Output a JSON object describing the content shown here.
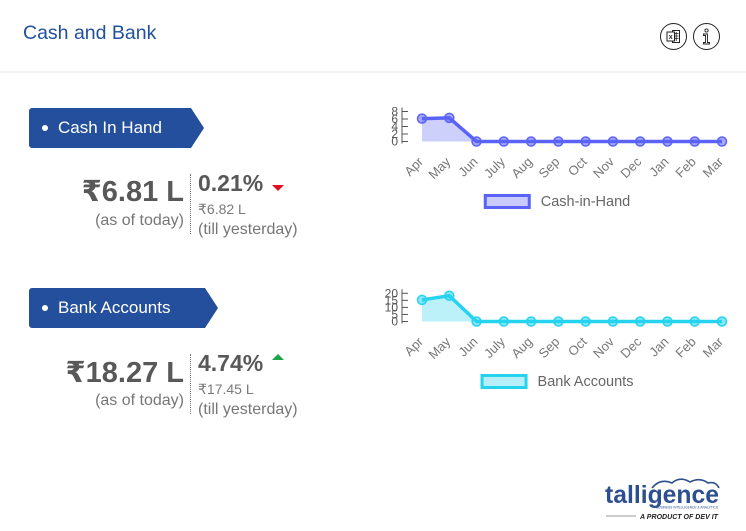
{
  "header": {
    "title": "Cash and Bank",
    "excel_icon": "excel-export-icon",
    "info_icon": "info-icon"
  },
  "colors": {
    "title": "#22509c",
    "pill": "#244f9c",
    "trend_down": "#e01020",
    "trend_up": "#19a64a"
  },
  "sections": [
    {
      "label": "Cash In Hand",
      "value": "₹6.81 L",
      "value_caption": "(as of today)",
      "change_percent": "0.21%",
      "change_direction": "down",
      "previous_value": "₹6.82 L",
      "previous_caption": "(till yesterday)"
    },
    {
      "label": "Bank Accounts",
      "value": "₹18.27 L",
      "value_caption": "(as of today)",
      "change_percent": "4.74%",
      "change_direction": "up",
      "previous_value": "₹17.45 L",
      "previous_caption": "(till yesterday)"
    }
  ],
  "chart_data": [
    {
      "type": "area",
      "title": "",
      "xlabel": "",
      "ylabel": "",
      "categories": [
        "Apr",
        "May",
        "Jun",
        "July",
        "Aug",
        "Sep",
        "Oct",
        "Nov",
        "Dec",
        "Jan",
        "Feb",
        "Mar"
      ],
      "series": [
        {
          "name": "Cash-in-Hand",
          "values": [
            6.1,
            6.3,
            0,
            0,
            0,
            0,
            0,
            0,
            0,
            0,
            0,
            0
          ],
          "line_color": "#5b63f6",
          "fill_color": "#c8cbfb"
        }
      ],
      "yticks": [
        0,
        2,
        4,
        6,
        8
      ],
      "ylim": [
        0,
        8
      ],
      "grid": false,
      "legend": "bottom"
    },
    {
      "type": "area",
      "title": "",
      "xlabel": "",
      "ylabel": "",
      "categories": [
        "Apr",
        "May",
        "Jun",
        "July",
        "Aug",
        "Sep",
        "Oct",
        "Nov",
        "Dec",
        "Jan",
        "Feb",
        "Mar"
      ],
      "series": [
        {
          "name": "Bank Accounts",
          "values": [
            15.3,
            18.3,
            0,
            0,
            0,
            0,
            0,
            0,
            0,
            0,
            0,
            0
          ],
          "line_color": "#26d3ee",
          "fill_color": "#b6eff9"
        }
      ],
      "yticks": [
        0,
        5,
        10,
        15,
        20
      ],
      "ylim": [
        0,
        20
      ],
      "grid": false,
      "legend": "bottom"
    }
  ],
  "logo": {
    "brand": "talligence",
    "tagline": "BUSINESS INTELLIGENCE & ANALYTICS",
    "product_of": "A PRODUCT OF DEV IT"
  }
}
